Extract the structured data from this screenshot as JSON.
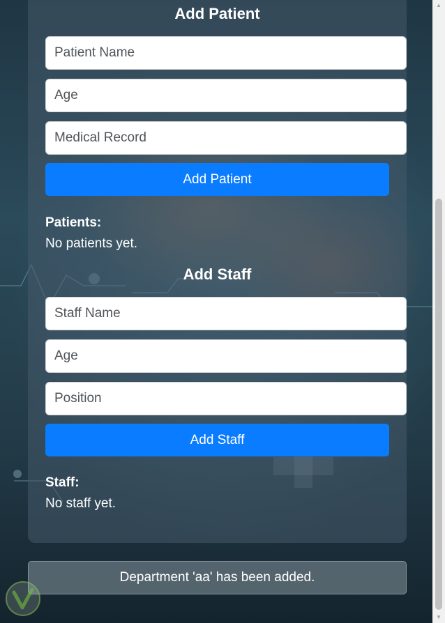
{
  "add_patient": {
    "title": "Add Patient",
    "name_placeholder": "Patient Name",
    "age_placeholder": "Age",
    "record_placeholder": "Medical Record",
    "button_label": "Add Patient",
    "list_heading": "Patients:",
    "empty_text": "No patients yet."
  },
  "add_staff": {
    "title": "Add Staff",
    "name_placeholder": "Staff Name",
    "age_placeholder": "Age",
    "position_placeholder": "Position",
    "button_label": "Add Staff",
    "list_heading": "Staff:",
    "empty_text": "No staff yet."
  },
  "notification": {
    "message": "Department 'aa' has been added."
  },
  "colors": {
    "primary_button": "#0a7cff",
    "panel": "#465a69",
    "text": "#ffffff"
  },
  "icons": {
    "scroll_up": "scroll-up-arrow-icon",
    "scroll_down": "scroll-down-arrow-icon",
    "logo": "logo-icon"
  }
}
